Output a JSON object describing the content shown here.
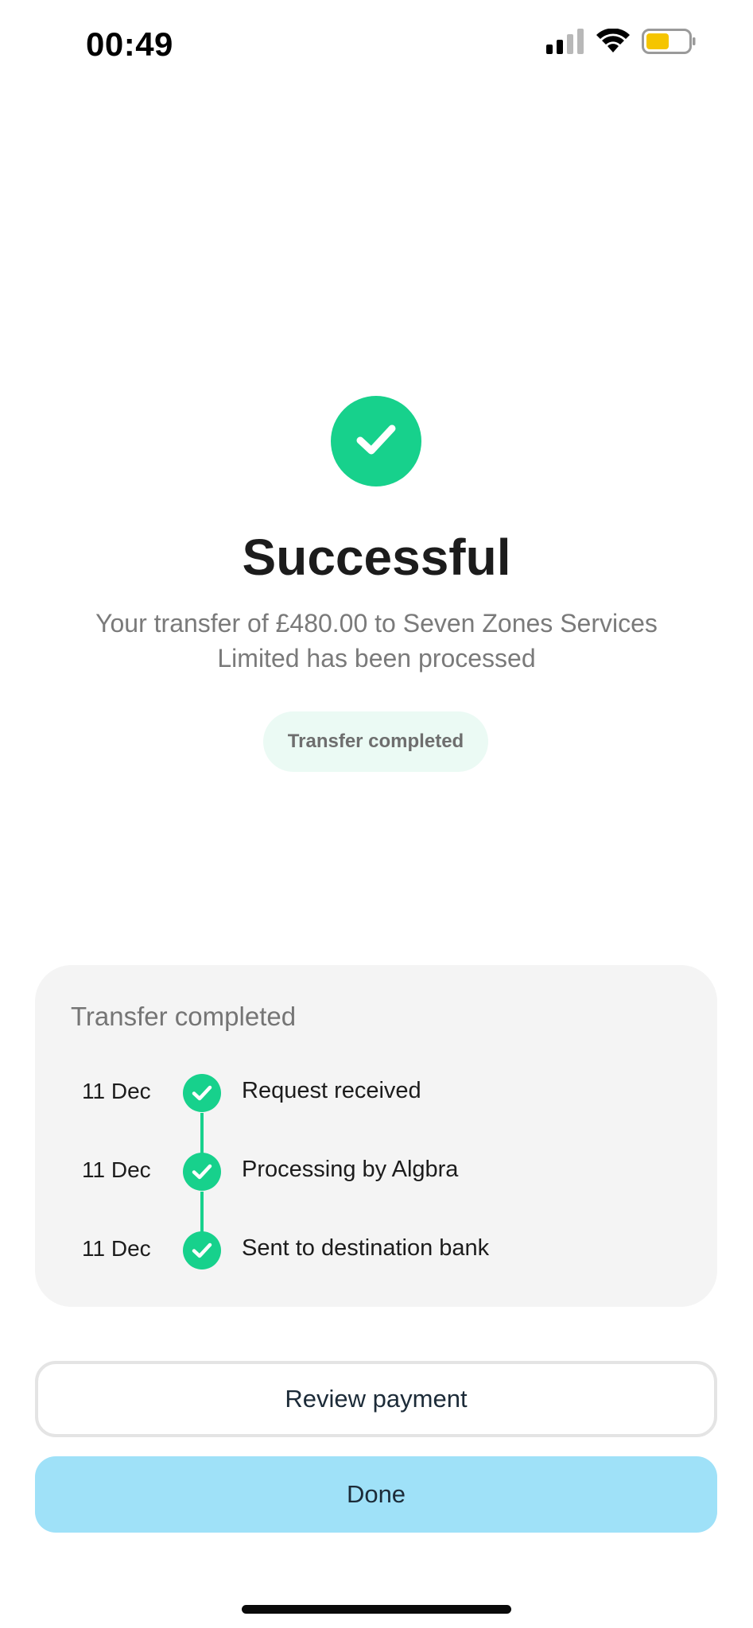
{
  "status_bar": {
    "time": "00:49",
    "icons": [
      "signal-icon",
      "wifi-icon",
      "battery-icon"
    ]
  },
  "hero": {
    "icon": "checkmark-icon",
    "title": "Successful",
    "subtitle": "Your transfer of £480.00 to Seven Zones Services Limited has been processed",
    "status_pill": "Transfer completed"
  },
  "timeline": {
    "title": "Transfer completed",
    "steps": [
      {
        "date": "11 Dec",
        "label": "Request received",
        "icon": "check-circle-icon"
      },
      {
        "date": "11 Dec",
        "label": "Processing by Algbra",
        "icon": "check-circle-icon"
      },
      {
        "date": "11 Dec",
        "label": "Sent to destination bank",
        "icon": "check-circle-icon"
      }
    ]
  },
  "actions": {
    "review_label": "Review payment",
    "done_label": "Done"
  },
  "colors": {
    "success": "#17d18c",
    "pill_bg": "#ebfaf4",
    "card_bg": "#f4f4f4",
    "primary_button": "#9fe1f8",
    "battery": "#f5c500"
  }
}
